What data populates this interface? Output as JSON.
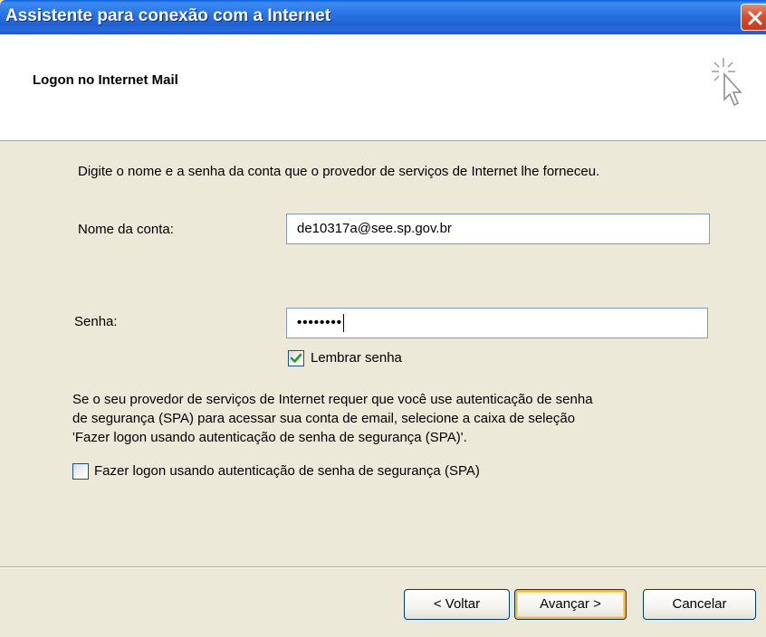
{
  "window": {
    "title": "Assistente para conexão com a Internet"
  },
  "header": {
    "heading": "Logon no Internet Mail"
  },
  "body": {
    "instruction": "Digite o nome e a senha da conta que o provedor de serviços de Internet lhe forneceu.",
    "account_label": "Nome da conta:",
    "account_value": "de10317a@see.sp.gov.br",
    "password_label": "Senha:",
    "password_value": "••••••••",
    "remember_password_label": "Lembrar senha",
    "remember_password_checked": true,
    "spa_description": [
      "Se o seu provedor de serviços de Internet requer que você use autenticação de senha",
      "de segurança (SPA) para acessar sua conta de email, selecione a caixa de seleção",
      "'Fazer logon usando autenticação de senha de segurança (SPA)'."
    ],
    "spa_checkbox_label": "Fazer logon usando autenticação de senha de segurança (SPA)",
    "spa_checked": false
  },
  "buttons": {
    "back": "< Voltar",
    "next": "Avançar >",
    "cancel": "Cancelar"
  },
  "icons": {
    "close": "close-icon",
    "wizard": "cursor-sparkle-icon",
    "check": "checkmark-icon"
  },
  "colors": {
    "titlebar": "#2a75e6",
    "close_button": "#d9502f",
    "checkmark": "#21a121",
    "dialog_background": "#ece9d8",
    "default_button_border": "#f8b636"
  }
}
